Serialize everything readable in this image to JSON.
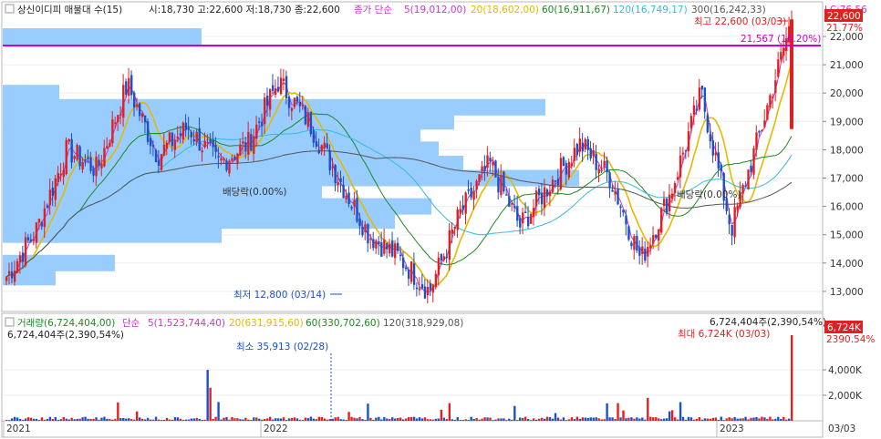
{
  "header": {
    "title": "상신이디피 매물대 수(15)",
    "ohlc": "시:18,730 고:22,600 저:18,730 종:22,600",
    "ma_prefix": "종가 단순",
    "ma_items": [
      {
        "label": "5(19,012,00)",
        "color": "#cc33cc"
      },
      {
        "label": "20(18,602,00)",
        "color": "#e6b800"
      },
      {
        "label": "60(16,911,67)",
        "color": "#1a8a1a"
      },
      {
        "label": "120(16,749,17)",
        "color": "#33bbdd"
      },
      {
        "label": "300(16,242,33)",
        "color": "#555555"
      }
    ],
    "lc": "LC:76.56"
  },
  "annotations": {
    "high": "최고 22,600 (03/03)",
    "low": "최저 12,800 (03/14)",
    "divider_line": "21,567 (16.20%)",
    "dividend_1": "배당락(0.00%)",
    "dividend_2": "배당락(0.00%)",
    "price_badge": "22,600",
    "price_badge_pct": "21.77%",
    "vol_badge": "6,724K",
    "vol_badge_pct": "2390.54%",
    "vol_max": "최대 6,724K (03/03)",
    "vol_min": "최소 35,913 (02/28)",
    "vol_top_right": "6,724,404주(2,390,54%)",
    "vol_left": "6,724,404주(2,390,54%)"
  },
  "volume_header": {
    "title": "거래량(6,724,404,00)",
    "ma_prefix": "단순",
    "ma_items": [
      {
        "label": "5(1,523,744,40)",
        "color": "#cc33cc"
      },
      {
        "label": "20(631,915,60)",
        "color": "#e6b800"
      },
      {
        "label": "60(330,702,60)",
        "color": "#1a8a1a"
      },
      {
        "label": "120(318,929,08)",
        "color": "#555555"
      }
    ]
  },
  "axes": {
    "price_ticks": [
      "22,000",
      "21,000",
      "20,000",
      "19,000",
      "18,000",
      "17,000",
      "16,000",
      "15,000",
      "14,000",
      "13,000"
    ],
    "volume_ticks": [
      "4,000K",
      "2,000K"
    ],
    "date_ticks": [
      "2021",
      "2022",
      "2023"
    ],
    "last_date": "03/03"
  },
  "colors": {
    "up": "#e02020",
    "down": "#1a50c8",
    "highlight": "#cc00cc",
    "profile": "#99ccff"
  },
  "chart_data": {
    "type": "candlestick",
    "title": "상신이디피 매물대 수(15)",
    "x_range": [
      "2021",
      "03/03"
    ],
    "ylim": [
      12600,
      22700
    ],
    "close_path": [
      {
        "x": "2021-01",
        "y": 13500
      },
      {
        "x": "2021-02",
        "y": 15200
      },
      {
        "x": "2021-03",
        "y": 18000
      },
      {
        "x": "2021-04",
        "y": 17300
      },
      {
        "x": "2021-05",
        "y": 20300
      },
      {
        "x": "2021-06",
        "y": 17800
      },
      {
        "x": "2021-07",
        "y": 18800
      },
      {
        "x": "2021-08",
        "y": 17500
      },
      {
        "x": "2021-09",
        "y": 18200
      },
      {
        "x": "2021-10",
        "y": 20400
      },
      {
        "x": "2021-11",
        "y": 19000
      },
      {
        "x": "2021-12",
        "y": 17000
      },
      {
        "x": "2022-01",
        "y": 15000
      },
      {
        "x": "2022-02",
        "y": 14200
      },
      {
        "x": "2022-03",
        "y": 13000
      },
      {
        "x": "2022-04",
        "y": 15700
      },
      {
        "x": "2022-05",
        "y": 17500
      },
      {
        "x": "2022-06",
        "y": 15300
      },
      {
        "x": "2022-07",
        "y": 16800
      },
      {
        "x": "2022-08",
        "y": 18200
      },
      {
        "x": "2022-09",
        "y": 17000
      },
      {
        "x": "2022-10",
        "y": 14100
      },
      {
        "x": "2022-11",
        "y": 16500
      },
      {
        "x": "2022-12",
        "y": 20000
      },
      {
        "x": "2023-01",
        "y": 15200
      },
      {
        "x": "2023-02",
        "y": 18800
      },
      {
        "x": "2023-03",
        "y": 22600
      }
    ],
    "volume_profile_rows": 15,
    "volume_peak": 6724404
  }
}
